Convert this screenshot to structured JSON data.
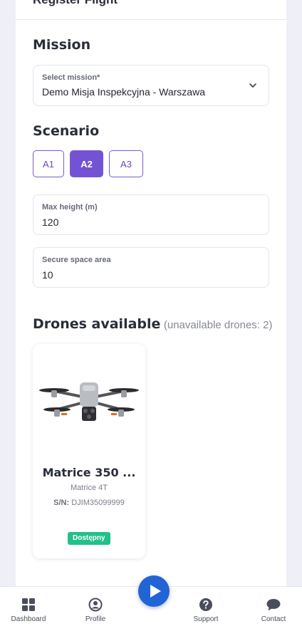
{
  "header": {
    "title": "Register Flight"
  },
  "mission": {
    "section_title": "Mission",
    "select_label": "Select mission*",
    "selected_value": "Demo Misja Inspekcyjna - Warszawa"
  },
  "scenario": {
    "section_title": "Scenario",
    "options": [
      "A1",
      "A2",
      "A3"
    ],
    "selected": "A2"
  },
  "max_height": {
    "label": "Max height (m)",
    "value": "120"
  },
  "secure_space": {
    "label": "Secure space area",
    "value": "10"
  },
  "drones": {
    "title": "Drones available",
    "unavailable_note": "(unavailable drones: 2)",
    "items": [
      {
        "name": "Matrice 350 ...",
        "model": "Matrice 4T",
        "sn_label": "S/N:",
        "sn_value": "DJIM35099999",
        "status": "Dostępny"
      }
    ]
  },
  "bottom_nav": {
    "items": [
      {
        "label": "Dashboard",
        "icon": "dashboard-icon"
      },
      {
        "label": "Profile",
        "icon": "profile-icon"
      },
      {
        "label": "Support",
        "icon": "help-icon"
      },
      {
        "label": "Contact",
        "icon": "chat-icon"
      }
    ],
    "center_action_icon": "play-icon"
  },
  "colors": {
    "accent": "#7353d4",
    "status_available": "#22c08a",
    "play_button": "#2264d6"
  }
}
